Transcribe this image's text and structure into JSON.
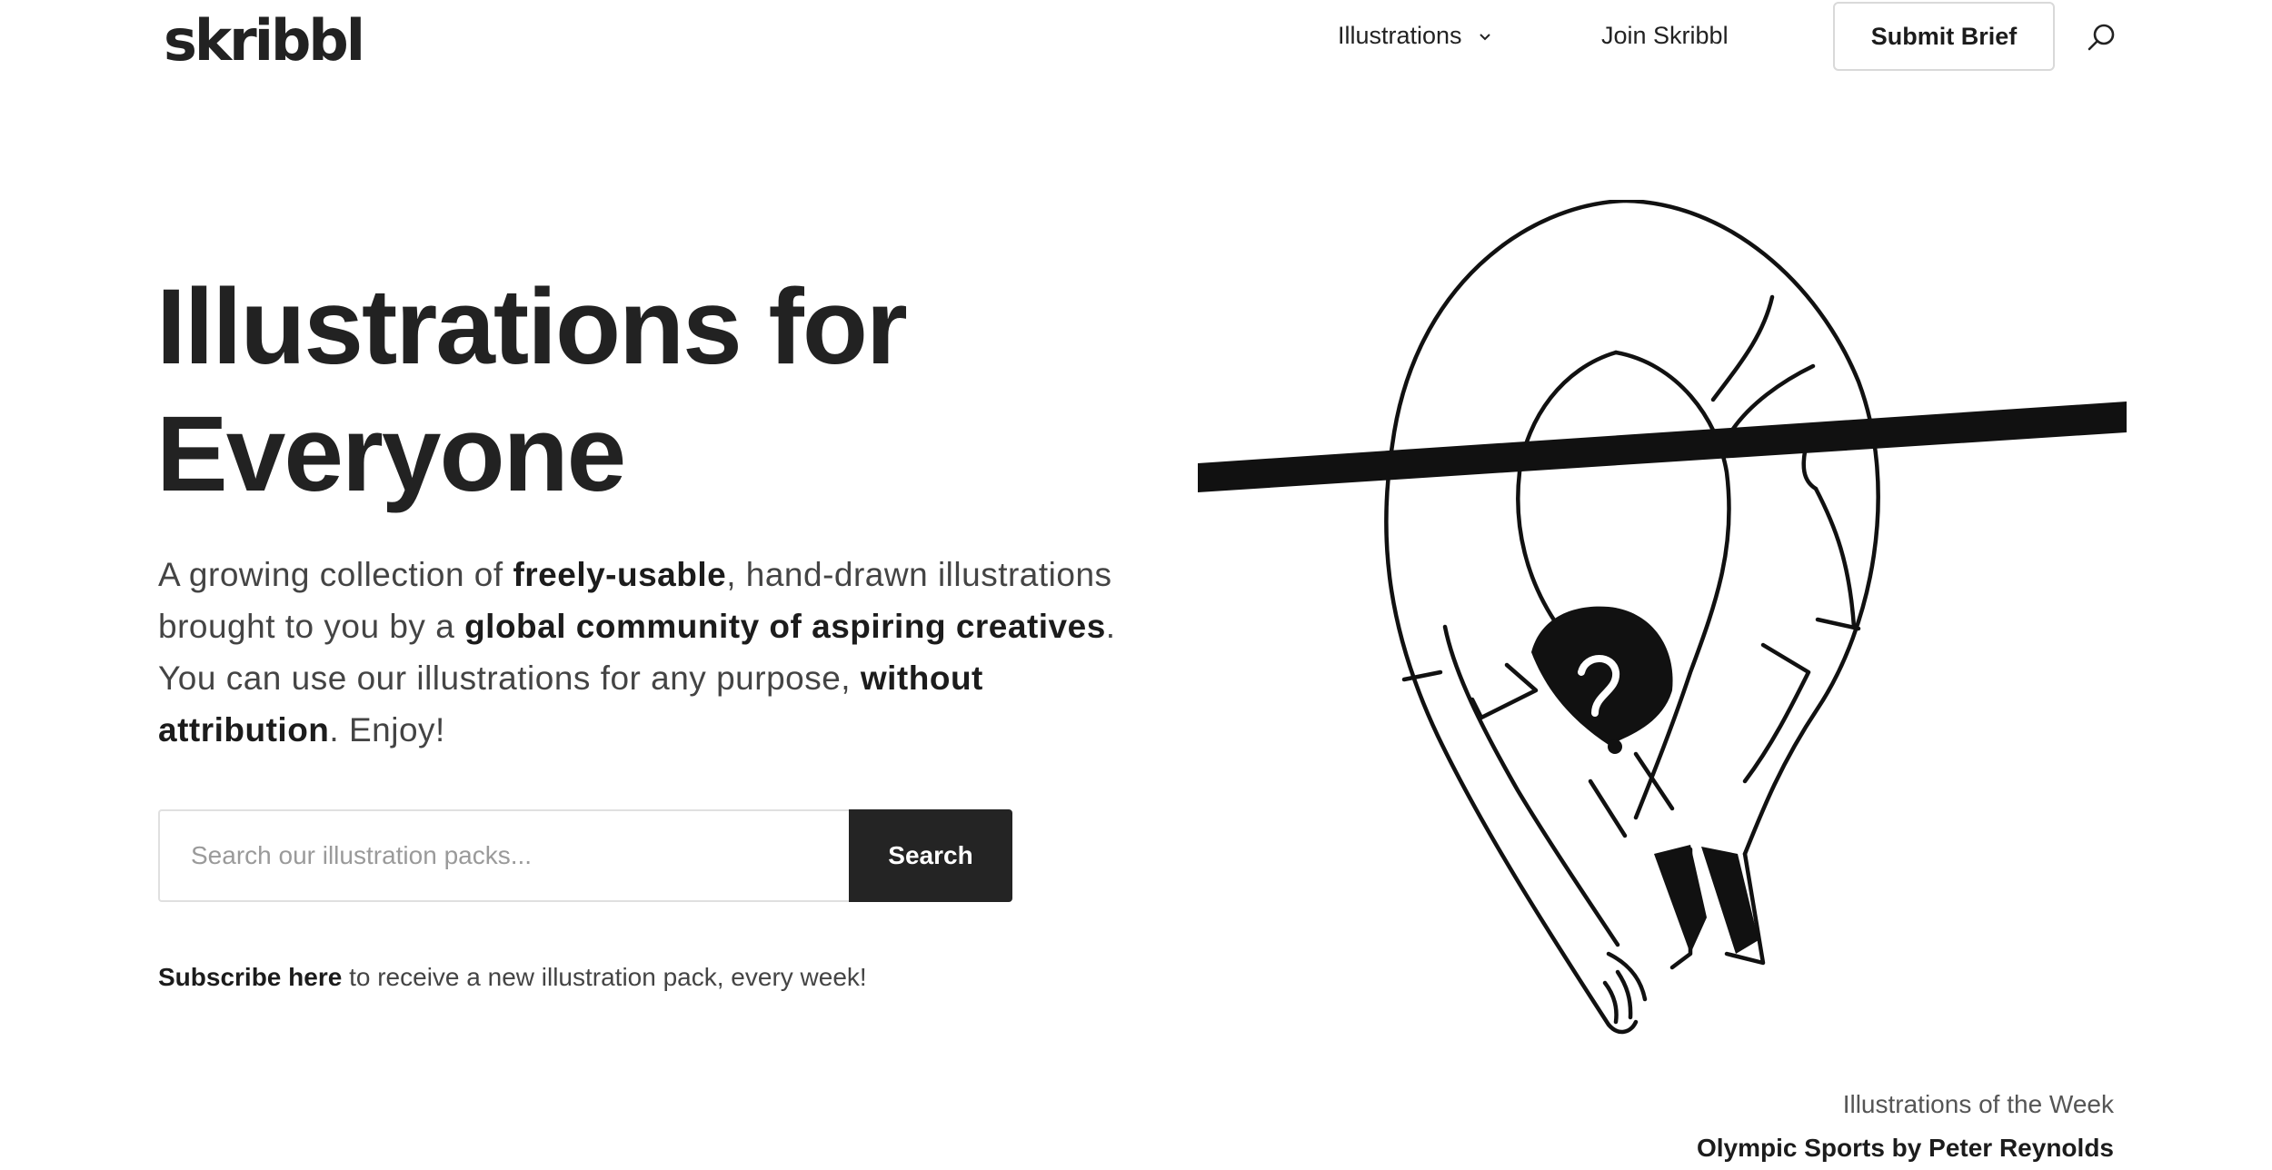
{
  "header": {
    "logo": "skribbl",
    "nav": {
      "illustrations_label": "Illustrations",
      "join_label": "Join Skribbl",
      "submit_label": "Submit Brief"
    }
  },
  "hero": {
    "title_line1": "Illustrations for",
    "title_line2": "Everyone",
    "desc": {
      "p1": "A growing collection of ",
      "b1": "freely-usable",
      "p2": ", hand-drawn illustrations brought to you by a ",
      "b2": "global community of aspiring creatives",
      "p3": ". You can use our illustrations for any purpose, ",
      "b3": "without attribution",
      "p4": ". Enjoy!"
    },
    "search": {
      "placeholder": "Search our illustration packs...",
      "button_label": "Search"
    },
    "subscribe": {
      "link": "Subscribe here",
      "text": " to receive a new illustration pack, every week!"
    }
  },
  "featured": {
    "label": "Illustrations of the Week",
    "title": "Olympic Sports by Peter Reynolds"
  },
  "colors": {
    "text": "#222222",
    "button_bg": "#242424",
    "border": "#e0e0e0"
  }
}
